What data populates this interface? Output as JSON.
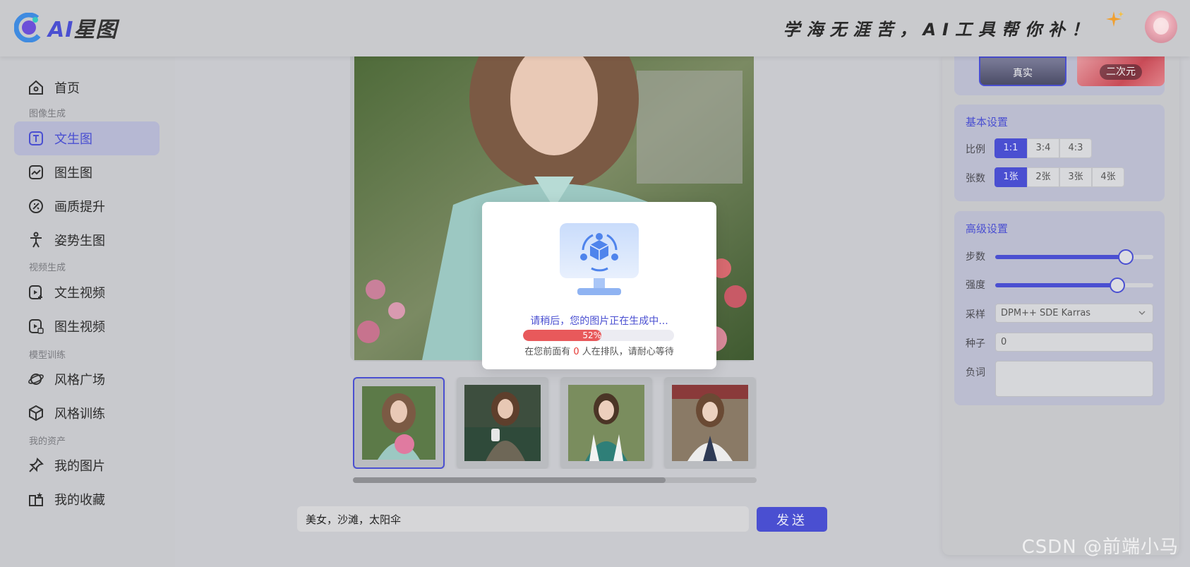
{
  "header": {
    "logo_text_ai": "AI",
    "logo_text_name": "星图",
    "slogan": "学海无涯苦，AI工具帮你补！"
  },
  "sidebar": {
    "items": [
      {
        "label": "首页",
        "icon": "home-icon"
      },
      {
        "section": "图像生成"
      },
      {
        "label": "文生图",
        "icon": "text-t-icon",
        "active": true
      },
      {
        "label": "图生图",
        "icon": "image-icon"
      },
      {
        "label": "画质提升",
        "icon": "enhance-icon"
      },
      {
        "label": "姿势生图",
        "icon": "pose-icon"
      },
      {
        "section": "视频生成"
      },
      {
        "label": "文生视频",
        "icon": "text-video-icon"
      },
      {
        "label": "图生视频",
        "icon": "image-video-icon"
      },
      {
        "section": "模型训练"
      },
      {
        "label": "风格广场",
        "icon": "planet-icon"
      },
      {
        "label": "风格训练",
        "icon": "cube-icon"
      },
      {
        "section": "我的资产"
      },
      {
        "label": "我的图片",
        "icon": "pin-icon"
      },
      {
        "label": "我的收藏",
        "icon": "star-folder-icon"
      }
    ]
  },
  "prompt": {
    "value": "美女，沙滩，太阳伞",
    "send_label": "发送"
  },
  "style_tiles": [
    "真实",
    "二次元"
  ],
  "basic": {
    "title": "基本设置",
    "ratio_label": "比例",
    "ratio_options": [
      "1:1",
      "3:4",
      "4:3"
    ],
    "ratio_selected": "1:1",
    "count_label": "张数",
    "count_options": [
      "1张",
      "2张",
      "3张",
      "4张"
    ],
    "count_selected": "1张"
  },
  "advanced": {
    "title": "高级设置",
    "steps_label": "步数",
    "steps_fraction": 0.82,
    "strength_label": "强度",
    "strength_fraction": 0.77,
    "sampler_label": "采样",
    "sampler_value": "DPM++ SDE Karras",
    "seed_label": "种子",
    "seed_value": "0",
    "negative_label": "负词",
    "negative_value": ""
  },
  "modal": {
    "message": "请稍后，您的图片正在生成中...",
    "progress_percent": 52,
    "progress_text": "52%",
    "queue_prefix": "在您前面有",
    "queue_count": "0",
    "queue_suffix": "人在排队，请耐心等待"
  },
  "colors": {
    "accent": "#4a4fd1",
    "progress": "#e8595b",
    "queue_count": "#e53935"
  },
  "watermark": "CSDN @前端小马"
}
